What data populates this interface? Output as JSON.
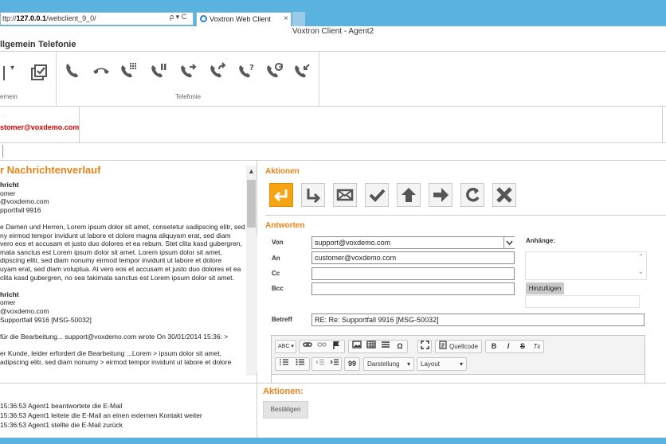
{
  "browser": {
    "address_prefix": "ttp://",
    "address_host": "127.0.0.1",
    "address_path": "/webclient_9_0/",
    "address_icons": "ρ ▾ C",
    "tab_title": "Voxtron Web Client",
    "tab_close": "×"
  },
  "app": {
    "title": "Voxtron Client  -   Agent2"
  },
  "menu": {
    "allgemein": "llgemein",
    "telefonie": "Telefonie"
  },
  "ribbon": {
    "group_allgemein_label": "emein",
    "group_telefonie_label": "Telefonie",
    "allgemein_dropdown": "▾",
    "telefonie_icons": [
      "phone-icon",
      "hangup-icon",
      "dialpad-icon",
      "hold-icon",
      "transfer-icon",
      "forward-icon",
      "consult-icon",
      "conference-icon",
      "callback-icon"
    ]
  },
  "contact": {
    "email": "stomer@voxdemo.com"
  },
  "history": {
    "title": "r Nachrichtenverlauf",
    "lines": [
      {
        "text": "hricht",
        "bold": true
      },
      {
        "text": "omer",
        "bold": false
      },
      {
        "text": "@voxdemo.com",
        "bold": false
      },
      {
        "text": "pportfall 9916",
        "bold": false
      },
      {
        "text": "",
        "bold": false
      },
      {
        "text": "e Damen und Herren, Lorem ipsum dolor sit amet, consetetur sadipscing elitr, sed",
        "bold": false
      },
      {
        "text": "ny eirmod tempor invidunt ut labore et dolore magna aliquyam erat, sed diam",
        "bold": false
      },
      {
        "text": " vero eos et accusam et justo duo dolores et ea rebum. Stet clita kasd gubergren,",
        "bold": false
      },
      {
        "text": "mata sanctus est Lorem ipsum dolor sit amet. Lorem ipsum dolor sit amet,",
        "bold": false
      },
      {
        "text": "dipscing elitr, sed diam nonumy eirmod tempor invidunt ut labore et dolore",
        "bold": false
      },
      {
        "text": "uyam erat, sed diam voluptua. At vero eos et accusam et justo duo dolores et ea",
        "bold": false
      },
      {
        "text": " clita kasd gubergren, no sea takimata sanctus est Lorem ipsum dolor sit amet.",
        "bold": false
      },
      {
        "text": "",
        "bold": false
      },
      {
        "text": "hricht",
        "bold": true
      },
      {
        "text": "omer",
        "bold": false
      },
      {
        "text": "@voxdemo.com",
        "bold": false
      },
      {
        "text": " Supportfall 9916 [MSG-50032]",
        "bold": false
      },
      {
        "text": "",
        "bold": false
      },
      {
        "text": " für die Bearbeitung... support@voxdemo.com wrote On 30/01/2014 15:36: >",
        "bold": false
      },
      {
        "text": "",
        "bold": false
      },
      {
        "text": "er Kunde, leider erfordert die Bearbeitung ...Lorem > ipsum dolor sit amet,",
        "bold": false
      },
      {
        "text": "adipscing elitr, sed diam nonumy > eirmod tempor invidunt ut labore et dolore",
        "bold": false
      }
    ],
    "scroll_up": "▲",
    "scroll_down": "▼"
  },
  "log": [
    "15:36:53 Agent1 beantwortete die E-Mail",
    "15:36:53 Agent1 leitete die E-Mail an einen externen Kontakt weiter",
    "15:36:53 Agent1 stellte die E-Mail zurück"
  ],
  "actions": {
    "title": "Aktionen",
    "buttons": [
      "reply-icon",
      "forward-down-icon",
      "envelope-icon",
      "checkmark-icon",
      "arrow-up-icon",
      "arrow-right-icon",
      "refresh-icon",
      "close-x-icon"
    ],
    "accent_color": "#f7a414"
  },
  "reply": {
    "title": "Antworten",
    "von_label": "Von",
    "von_value": "support@voxdemo.com",
    "an_label": "An",
    "an_value": "customer@voxdemo.com",
    "cc_label": "Cc",
    "cc_value": "",
    "bcc_label": "Bcc",
    "bcc_value": "",
    "betreff_label": "Betreff",
    "betreff_value": "RE: Re: Supportfall 9916 [MSG-50032]",
    "anhange_label": "Anhänge:",
    "hinzufuegen_label": "Hinzufügen",
    "scroll_up": "⌃",
    "scroll_down": "⌄"
  },
  "editor": {
    "spell": "ABC ▾",
    "quellcode": "Quellcode",
    "bold": "B",
    "italic": "I",
    "strike": "S",
    "clear": "Tx",
    "darstellung": "Darstellung",
    "layout": "Layout",
    "quote": "99",
    "omega": "Ω"
  },
  "bottom": {
    "aktionen_title": "Aktionen:",
    "bestaetigen_label": "Bestätigen"
  },
  "colors": {
    "browser_blue": "#5ab3df",
    "heading_orange": "#e8841a",
    "contact_red": "#d10000"
  }
}
